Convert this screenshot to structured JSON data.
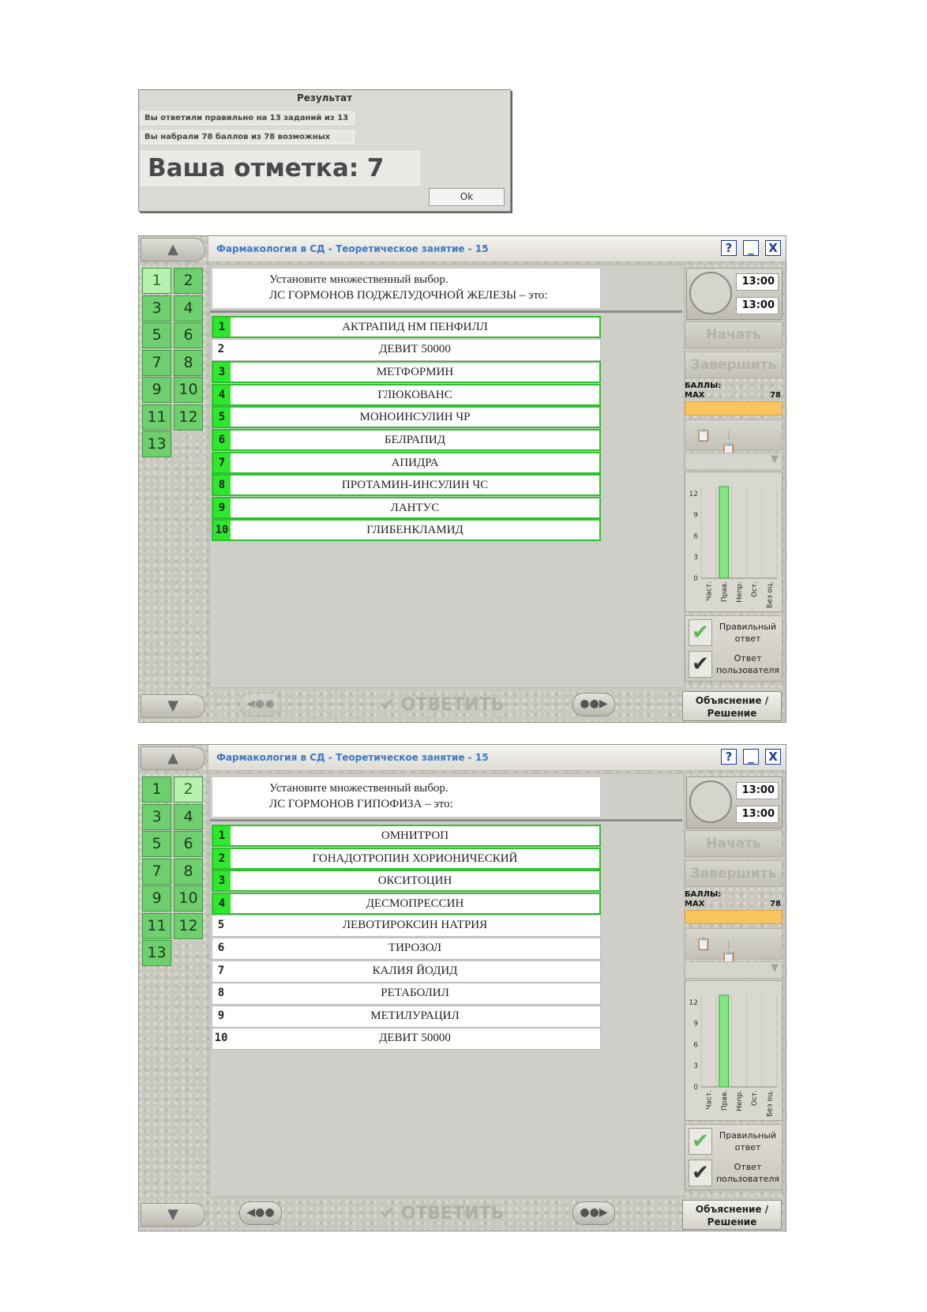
{
  "result": {
    "title": "Результат",
    "line1": "Вы ответили правильно на 13 заданий из 13",
    "line2": "Вы набрали 78 баллов из 78 возможных",
    "mark": "Ваша отметка: 7",
    "ok_label": "Ok"
  },
  "common": {
    "window_title": "Фармакология в СД - Теоретическое занятие - 15",
    "help_label": "?",
    "minimize_label": "_",
    "close_label": "X",
    "scroll_up": "▲",
    "scroll_down": "▼",
    "nav_numbers": [
      "1",
      "2",
      "3",
      "4",
      "5",
      "6",
      "7",
      "8",
      "9",
      "10",
      "11",
      "12",
      "13"
    ],
    "time_total": "13:00",
    "time_left": "13:00",
    "start_label": "Начать",
    "finish_label": "Завершить",
    "score_label": "БАЛЛЫ:",
    "max_label": "MAX",
    "max_value": "78",
    "prev_label": "◀●●",
    "next_label": "●●▶",
    "answer_label": "✔ ОТВЕТИТЬ",
    "explain_line1": "Объяснение /",
    "explain_line2": "Решение",
    "legend_correct_line1": "Правильный",
    "legend_correct_line2": "ответ",
    "legend_user_line1": "Ответ",
    "legend_user_line2": "пользователя",
    "check_mark": "✔",
    "chart_icon_1": "📋",
    "chart_icon_2": "i📋",
    "dropdown_arrow": "▼"
  },
  "windows": [
    {
      "current_question": 1,
      "question_line1": "Установите множественный выбор.",
      "question_line2": "ЛС ГОРМОНОВ ПОДЖЕЛУДОЧНОЙ ЖЕЛЕЗЫ – это:",
      "prev_enabled": false,
      "options": [
        {
          "num": "1",
          "text": "АКТРАПИД НМ ПЕНФИЛЛ",
          "selected": true
        },
        {
          "num": "2",
          "text": "ДЕВИТ 50000",
          "selected": false
        },
        {
          "num": "3",
          "text": "МЕТФОРМИН",
          "selected": true
        },
        {
          "num": "4",
          "text": "ГЛЮКОВАНС",
          "selected": true
        },
        {
          "num": "5",
          "text": "МОНОИНСУЛИН ЧР",
          "selected": true
        },
        {
          "num": "6",
          "text": "БЕЛРАПИД",
          "selected": true
        },
        {
          "num": "7",
          "text": "АПИДРА",
          "selected": true
        },
        {
          "num": "8",
          "text": "ПРОТАМИН-ИНСУЛИН ЧС",
          "selected": true
        },
        {
          "num": "9",
          "text": "ЛАНТУС",
          "selected": true
        },
        {
          "num": "10",
          "text": "ГЛИБЕНКЛАМИД",
          "selected": true
        }
      ]
    },
    {
      "current_question": 2,
      "question_line1": "Установите множественный выбор.",
      "question_line2": "ЛС ГОРМОНОВ ГИПОФИЗА – это:",
      "prev_enabled": true,
      "options": [
        {
          "num": "1",
          "text": "ОМНИТРОП",
          "selected": true
        },
        {
          "num": "2",
          "text": "ГОНАДОТРОПИН ХОРИОНИЧЕСКИЙ",
          "selected": true
        },
        {
          "num": "3",
          "text": "ОКСИТОЦИН",
          "selected": true
        },
        {
          "num": "4",
          "text": "ДЕСМОПРЕССИН",
          "selected": true
        },
        {
          "num": "5",
          "text": "ЛЕВОТИРОКСИН НАТРИЯ",
          "selected": false
        },
        {
          "num": "6",
          "text": "ТИРОЗОЛ",
          "selected": false
        },
        {
          "num": "7",
          "text": "КАЛИЯ ЙОДИД",
          "selected": false
        },
        {
          "num": "8",
          "text": "РЕТАБОЛИЛ",
          "selected": false
        },
        {
          "num": "9",
          "text": "МЕТИЛУРАЦИЛ",
          "selected": false
        },
        {
          "num": "10",
          "text": "ДЕВИТ 50000",
          "selected": false
        }
      ]
    }
  ],
  "chart_data": {
    "type": "bar",
    "categories": [
      "Част.",
      "Прав.",
      "Непр.",
      "Ост.",
      "Без оц."
    ],
    "values": [
      0,
      13,
      0,
      0,
      0
    ],
    "ylim": [
      0,
      13
    ],
    "yticks": [
      0,
      3,
      6,
      9,
      12
    ],
    "bar_color": "#7ee87e"
  }
}
